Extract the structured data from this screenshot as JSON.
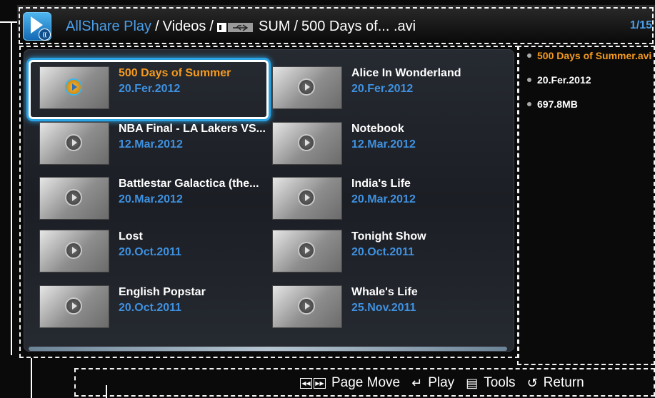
{
  "header": {
    "app_name": "AllShare Play",
    "separator": "/",
    "section": "Videos",
    "device": "SUM",
    "file": "500 Days of... .avi",
    "page": "1/15",
    "icons": [
      "allshare-play-icon",
      "usb-device-icon"
    ]
  },
  "videos": [
    {
      "title": "500 Days of Summer",
      "date": "20.Fer.2012",
      "selected": true
    },
    {
      "title": "Alice In Wonderland",
      "date": "20.Fer.2012"
    },
    {
      "title": "NBA Final - LA Lakers VS...",
      "date": "12.Mar.2012"
    },
    {
      "title": "Notebook",
      "date": "12.Mar.2012"
    },
    {
      "title": "Battlestar Galactica (the...",
      "date": "20.Mar.2012"
    },
    {
      "title": "India's Life",
      "date": "20.Mar.2012"
    },
    {
      "title": "Lost",
      "date": "20.Oct.2011"
    },
    {
      "title": "Tonight Show",
      "date": "20.Oct.2011"
    },
    {
      "title": "English Popstar",
      "date": "20.Oct.2011"
    },
    {
      "title": "Whale's Life",
      "date": "25.Nov.2011"
    }
  ],
  "info": {
    "name": "500 Days of Summer.avi",
    "date": "20.Fer.2012",
    "size": "697.8MB"
  },
  "footer": {
    "page_move": "Page Move",
    "play": "Play",
    "tools": "Tools",
    "return": "Return",
    "icons": [
      "rewind-key-icon",
      "forward-key-icon",
      "enter-icon",
      "tools-icon",
      "return-icon"
    ]
  },
  "colors": {
    "accent_blue": "#3f91e0",
    "selected_orange": "#f59a1f",
    "focus_glow": "#2ba4e6"
  }
}
